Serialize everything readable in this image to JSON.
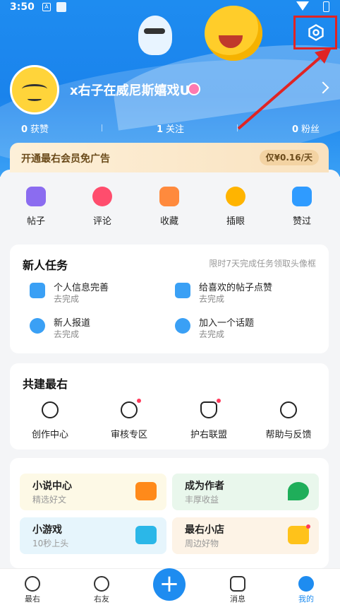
{
  "status": {
    "time": "3:50",
    "icon_a": "A"
  },
  "profile": {
    "username": "x右子在威尼斯嬉戏U",
    "stats": [
      {
        "value": "0",
        "label": "获赞"
      },
      {
        "value": "1",
        "label": "关注"
      },
      {
        "value": "0",
        "label": "粉丝"
      }
    ]
  },
  "vip": {
    "text": "开通最右会员免广告",
    "price": "仅¥0.16/天"
  },
  "quick": [
    {
      "label": "帖子",
      "icon": "post-icon",
      "color": "#8b6cf0"
    },
    {
      "label": "评论",
      "icon": "comment-icon",
      "color": "#ff4d6d"
    },
    {
      "label": "收藏",
      "icon": "favorite-icon",
      "color": "#ff8a3d"
    },
    {
      "label": "插眼",
      "icon": "eye-icon",
      "color": "#ffb400"
    },
    {
      "label": "赞过",
      "icon": "like-icon",
      "color": "#2f9bff"
    }
  ],
  "newbie": {
    "title": "新人任务",
    "subtitle": "限时7天完成任务领取头像框",
    "tasks": [
      {
        "title": "个人信息完善",
        "link": "去完成",
        "icon": "profile-task-icon",
        "color": "#3aa0f5"
      },
      {
        "title": "给喜欢的帖子点赞",
        "link": "去完成",
        "icon": "like-task-icon",
        "color": "#3aa0f5"
      },
      {
        "title": "新人报道",
        "link": "去完成",
        "icon": "checkin-task-icon",
        "color": "#3aa0f5"
      },
      {
        "title": "加入一个话题",
        "link": "去完成",
        "icon": "topic-task-icon",
        "color": "#3aa0f5"
      }
    ]
  },
  "cobuild": {
    "title": "共建最右",
    "items": [
      {
        "label": "创作中心",
        "icon": "lightbulb-icon"
      },
      {
        "label": "审核专区",
        "icon": "review-icon"
      },
      {
        "label": "护右联盟",
        "icon": "shield-heart-icon"
      },
      {
        "label": "帮助与反馈",
        "icon": "help-icon"
      }
    ]
  },
  "tiles": [
    {
      "title": "小说中心",
      "sub": "精选好文",
      "icon": "book-icon",
      "bg": "#fdf9e6",
      "icon_color": "#ff8a1a"
    },
    {
      "title": "成为作者",
      "sub": "丰厚收益",
      "icon": "pen-icon",
      "bg": "#e9f7ec",
      "icon_color": "#1fae5a"
    },
    {
      "title": "小游戏",
      "sub": "10秒上头",
      "icon": "gamepad-icon",
      "bg": "#e6f5fc",
      "icon_color": "#2bb7e8"
    },
    {
      "title": "最右小店",
      "sub": "周边好物",
      "icon": "shop-icon",
      "bg": "#fdf3e6",
      "icon_color": "#ffc21a"
    }
  ],
  "tabs": [
    {
      "label": "最右",
      "icon": "home-icon"
    },
    {
      "label": "右友",
      "icon": "friends-icon"
    },
    {
      "label": "消息",
      "icon": "message-icon"
    },
    {
      "label": "我的",
      "icon": "profile-icon"
    }
  ],
  "colors": {
    "brand": "#1e8cf0",
    "highlight": "#e02424"
  }
}
